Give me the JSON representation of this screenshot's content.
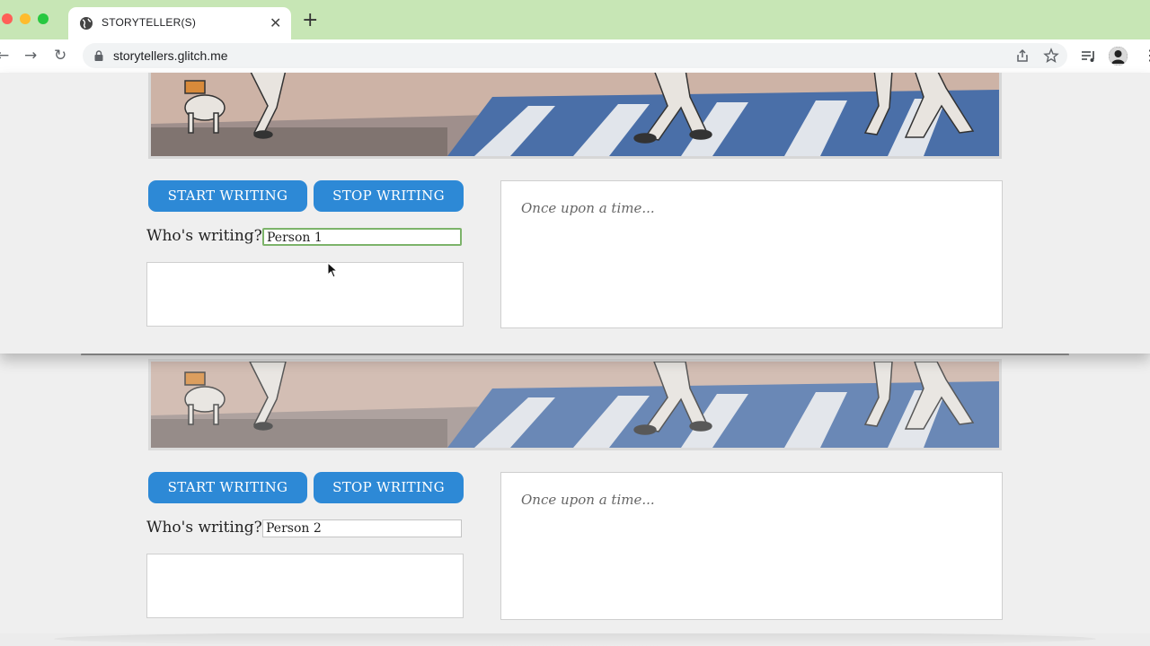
{
  "browser": {
    "tab_title": "STORYTELLER(S)",
    "tab_close": "✕",
    "new_tab": "+",
    "url": "storytellers.glitch.me",
    "back": "←",
    "forward": "→",
    "reload": "↻",
    "menu": "⋮"
  },
  "icons": {
    "tab": "globe-icon",
    "lock": "lock-icon",
    "share": "share-icon",
    "bookmark": "star-icon",
    "media": "media-control-icon",
    "profile": "avatar"
  },
  "colors": {
    "tabstrip": "#c7e6b5",
    "button": "#2d89d6",
    "active_input_border": "#7cb36a"
  },
  "windows": [
    {
      "start_label": "START WRITING",
      "stop_label": "STOP WRITING",
      "who_label": "Who's writing?",
      "who_value": "Person 1",
      "story_placeholder": "Once upon a time..."
    },
    {
      "start_label": "START WRITING",
      "stop_label": "STOP WRITING",
      "who_label": "Who's writing?",
      "who_value": "Person 2",
      "story_placeholder": "Once upon a time..."
    }
  ]
}
